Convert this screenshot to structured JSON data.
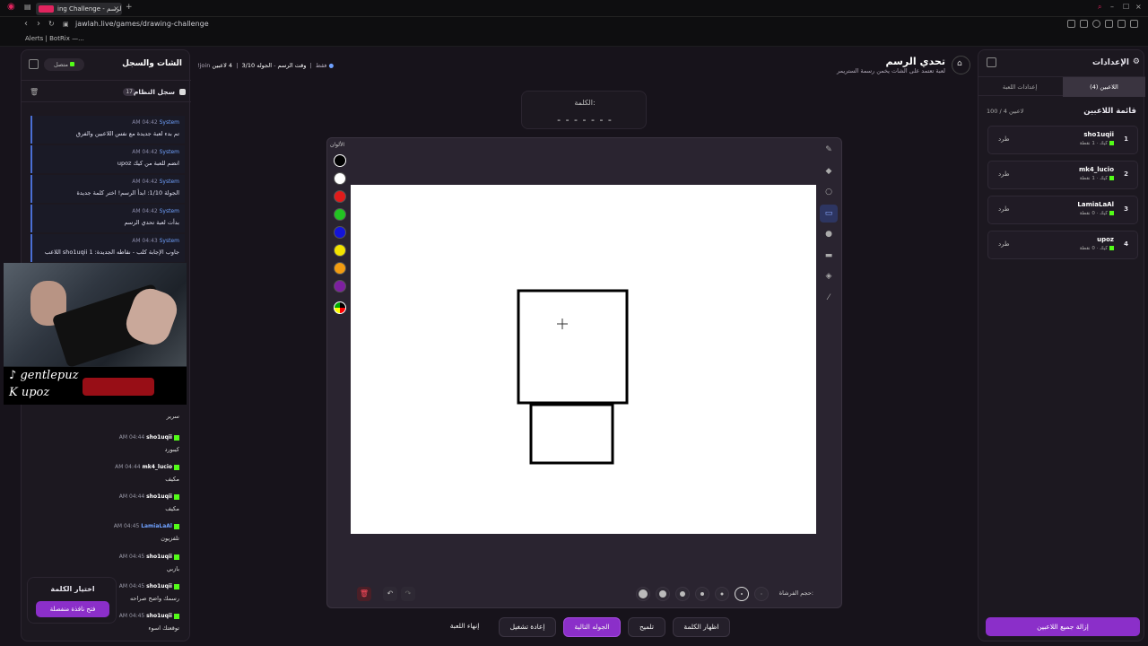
{
  "browser": {
    "tab_title": "ing Challenge - تحدي الرسم",
    "tab_close": "×",
    "new_tab": "+",
    "url": "jawlah.live/games/drawing-challenge",
    "bookmark": "Alerts | BotRix —..."
  },
  "chat": {
    "title": "الشات والسجل",
    "connection": "متصل",
    "system_log_title": "سجل النظام",
    "system_log_count": "17",
    "system_messages": [
      {
        "time": "AM 04:42",
        "sender": "System",
        "text": "تم بدء لعبة جديدة مع نفس اللاعبين والفرق"
      },
      {
        "time": "AM 04:42",
        "sender": "System",
        "text": "upoz انضم للعبة من كيك"
      },
      {
        "time": "AM 04:42",
        "sender": "System",
        "text": "الجولة 1/10: ابدأ الرسم! اختر كلمة جديدة"
      },
      {
        "time": "AM 04:42",
        "sender": "System",
        "text": "بدأت لعبة تحدي الرسم"
      },
      {
        "time": "AM 04:43",
        "sender": "System",
        "text": "اللاعب sho1uqii جاوب الإجابة كلب - نقاطه الجديدة: 1"
      }
    ],
    "user_messages": [
      {
        "time": "",
        "user": "",
        "text": "سرير"
      },
      {
        "time": "AM 04:44",
        "user": "sho1uqii",
        "text": "كيبورد"
      },
      {
        "time": "AM 04:44",
        "user": "mk4_lucio",
        "text": "مكيف"
      },
      {
        "time": "AM 04:44",
        "user": "sho1uqii",
        "text": "مكيف"
      },
      {
        "time": "AM 04:45",
        "user": "LamiaLaAl",
        "text": "تلفزيون"
      },
      {
        "time": "AM 04:45",
        "user": "sho1uqii",
        "text": "بازبي"
      },
      {
        "time": "AM 04:45",
        "user": "sho1uqii",
        "text": "رسمك واضح صراحه"
      },
      {
        "time": "AM 04:45",
        "user": "sho1uqii",
        "text": "توقعتك اسوء"
      }
    ],
    "pick_word_title": "اختيار الكلمة",
    "open_window_button": "فتح نافذة منفصلة"
  },
  "cam_overlay": {
    "tiktok_handle": "gentlepuz",
    "kick_handle": "upoz"
  },
  "header": {
    "title": "تحدي الرسم",
    "subtitle": "لعبة تعتمد على الشات يخمن رسمة الستريمر",
    "players": "4 لاعبين",
    "round": "الجوله 3/10",
    "phase": "وقت الرسم",
    "join_hint": "!join فقط"
  },
  "word": {
    "label": "الكلمة:",
    "hint": "- - - - - - -"
  },
  "colors": {
    "label": "الألوان",
    "swatches": [
      "#000000",
      "#ffffff",
      "#e01b1b",
      "#22c322",
      "#1414d8",
      "#f4e400",
      "#f39c12",
      "#7d1fa0"
    ]
  },
  "tools": [
    "pencil-icon",
    "eraser-icon",
    "circle-icon",
    "rectangle-icon",
    "filled-circle-icon",
    "filled-rect-icon",
    "fill-icon",
    "line-icon"
  ],
  "brush": {
    "label": "حجم الفرشاة:",
    "sizes": [
      1,
      2,
      3,
      4,
      6,
      8,
      10
    ],
    "selected_index": 1
  },
  "actions": {
    "show_word": "اظهار الكلمة",
    "hint": "تلميح",
    "next_round": "الجوله التالية",
    "restart": "إعادة تشغيل",
    "end_game": "إنهاء اللعبة"
  },
  "settings": {
    "title": "الإعدادات",
    "tab_players": "اللاعبين (4)",
    "tab_game": "إعدادات اللعبة",
    "list_title": "قائمة اللاعبين",
    "count": "100 / 4 لاعبين",
    "kick_label": "طرد",
    "players": [
      {
        "rank": "1",
        "name": "sho1uqii",
        "points": "كيك · 1 نقطة"
      },
      {
        "rank": "2",
        "name": "mk4_lucio",
        "points": "كيك · 1 نقطة"
      },
      {
        "rank": "3",
        "name": "LamiaLaAl",
        "points": "كيك · 0 نقطة"
      },
      {
        "rank": "4",
        "name": "upoz",
        "points": "كيك · 0 نقطة"
      }
    ],
    "remove_all": "إزالة جميع اللاعبين"
  }
}
